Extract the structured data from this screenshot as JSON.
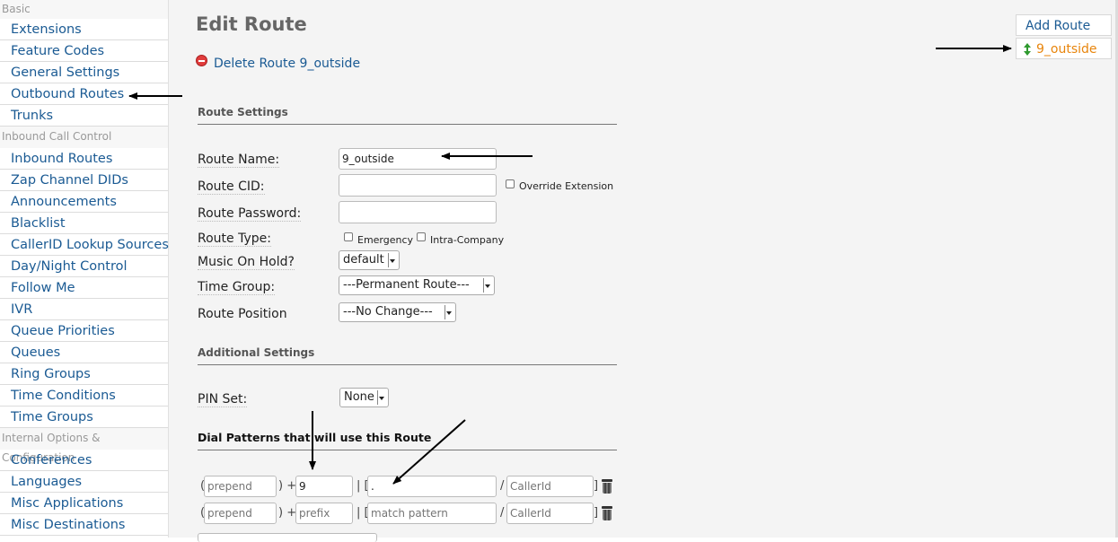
{
  "sidebar": {
    "sections": [
      {
        "title": "Basic",
        "items": [
          "Extensions",
          "Feature Codes",
          "General Settings",
          "Outbound Routes",
          "Trunks"
        ]
      },
      {
        "title": "Inbound Call Control",
        "items": [
          "Inbound Routes",
          "Zap Channel DIDs",
          "Announcements",
          "Blacklist",
          "CallerID Lookup Sources",
          "Day/Night Control",
          "Follow Me",
          "IVR",
          "Queue Priorities",
          "Queues",
          "Ring Groups",
          "Time Conditions",
          "Time Groups"
        ]
      },
      {
        "title": "Internal Options & Configuration",
        "items": [
          "Conferences",
          "Languages",
          "Misc Applications",
          "Misc Destinations"
        ]
      }
    ]
  },
  "page": {
    "title": "Edit Route",
    "delete_label": "Delete Route 9_outside"
  },
  "route_settings": {
    "heading": "Route Settings",
    "route_name_label": "Route Name:",
    "route_name_value": "9_outside",
    "route_cid_label": "Route CID:",
    "route_cid_value": "",
    "override_extension_label": "Override Extension",
    "route_password_label": "Route Password:",
    "route_password_value": "",
    "route_type_label": "Route Type:",
    "emergency_label": "Emergency",
    "intra_company_label": "Intra-Company",
    "moh_label": "Music On Hold?",
    "moh_value": "default",
    "time_group_label": "Time Group:",
    "time_group_value": "---Permanent Route---",
    "route_position_label": "Route Position",
    "route_position_value": "---No Change---"
  },
  "additional_settings": {
    "heading": "Additional Settings",
    "pin_set_label": "PIN Set:",
    "pin_set_value": "None"
  },
  "dial_patterns": {
    "heading": "Dial Patterns that will use this Route",
    "open_paren": "(",
    "plus": ") +",
    "pipe": "| [",
    "slash": "/",
    "close_bracket": "]",
    "rows": [
      {
        "prepend": "",
        "prepend_placeholder": "prepend",
        "prefix": "9",
        "prefix_placeholder": "prefix",
        "pattern": ".",
        "pattern_placeholder": "match pattern",
        "callerid": "",
        "callerid_placeholder": "CallerId"
      },
      {
        "prepend": "",
        "prepend_placeholder": "prepend",
        "prefix": "",
        "prefix_placeholder": "prefix",
        "pattern": "",
        "pattern_placeholder": "match pattern",
        "callerid": "",
        "callerid_placeholder": "CallerId"
      }
    ]
  },
  "right_nav": {
    "add_route_label": "Add Route",
    "route_item_label": "9_outside",
    "accent_color": "#e8850c"
  },
  "icons": {
    "delete": "delete-circle-icon",
    "trash": "trash-icon",
    "reorder": "up-down-arrow-icon"
  }
}
